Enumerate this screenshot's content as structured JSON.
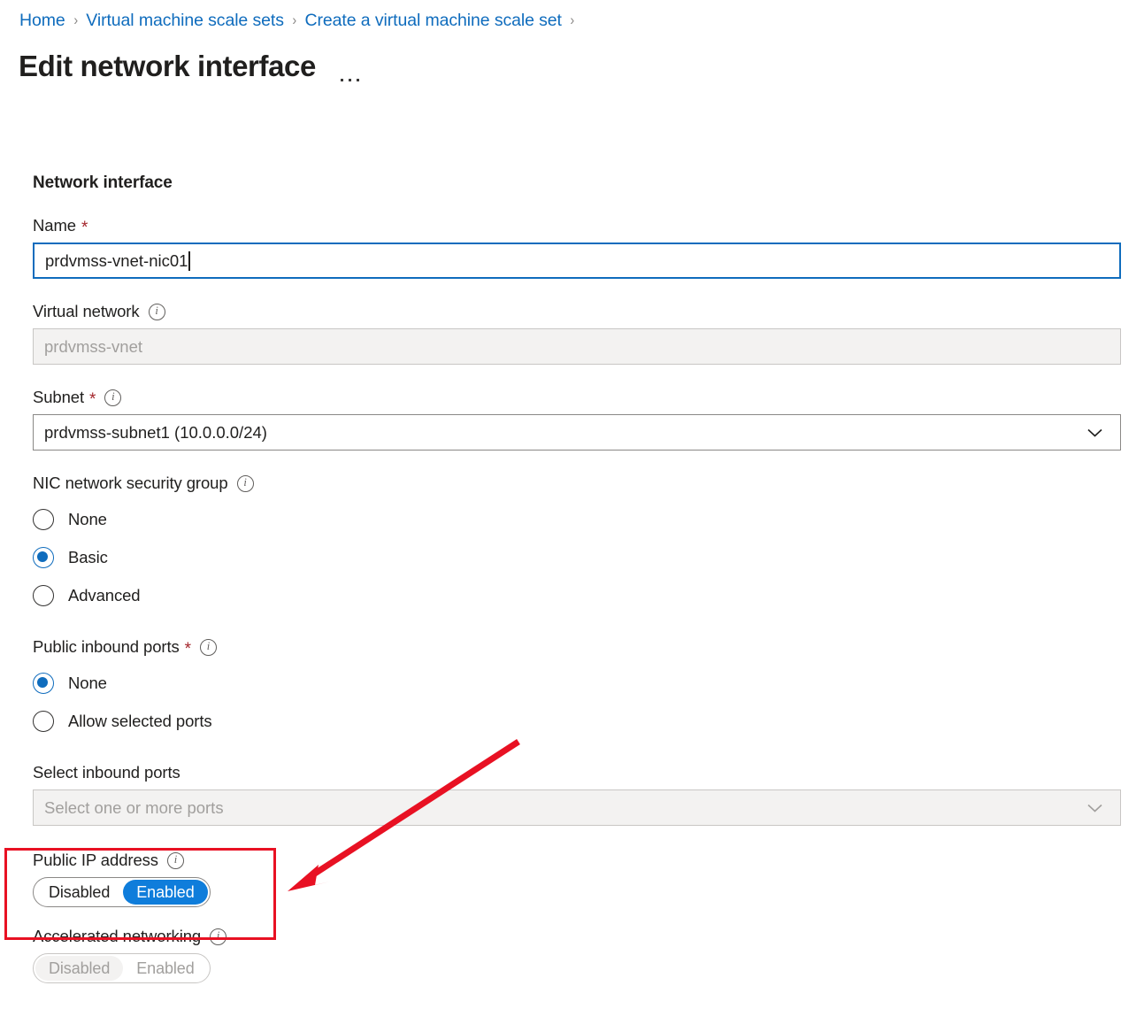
{
  "breadcrumb": {
    "items": [
      {
        "label": "Home"
      },
      {
        "label": "Virtual machine scale sets"
      },
      {
        "label": "Create a virtual machine scale set"
      }
    ],
    "separator": "›"
  },
  "header": {
    "title": "Edit network interface",
    "more_menu": "more-options"
  },
  "form": {
    "section_heading": "Network interface",
    "name": {
      "label": "Name",
      "required": "*",
      "value": "prdvmss-vnet-nic01"
    },
    "virtual_network": {
      "label": "Virtual network",
      "value": "prdvmss-vnet",
      "disabled": true
    },
    "subnet": {
      "label": "Subnet",
      "required": "*",
      "value": "prdvmss-subnet1 (10.0.0.0/24)"
    },
    "nic_nsg": {
      "label": "NIC network security group",
      "options": [
        "None",
        "Basic",
        "Advanced"
      ],
      "selected": "Basic"
    },
    "public_inbound_ports": {
      "label": "Public inbound ports",
      "required": "*",
      "options": [
        "None",
        "Allow selected ports"
      ],
      "selected": "None"
    },
    "select_inbound_ports": {
      "label": "Select inbound ports",
      "placeholder": "Select one or more ports",
      "disabled": true
    },
    "public_ip_address": {
      "label": "Public IP address",
      "options": [
        "Disabled",
        "Enabled"
      ],
      "selected": "Enabled"
    },
    "accelerated_networking": {
      "label": "Accelerated networking",
      "options": [
        "Disabled",
        "Enabled"
      ],
      "selected": "Disabled",
      "disabled": true
    }
  },
  "colors": {
    "link": "#0f6cbd",
    "accent": "#0f7ddb",
    "required": "#a4262c",
    "annotation": "#e81123"
  },
  "icons": {
    "info": "i",
    "chevron_down": "chevron-down-icon"
  }
}
